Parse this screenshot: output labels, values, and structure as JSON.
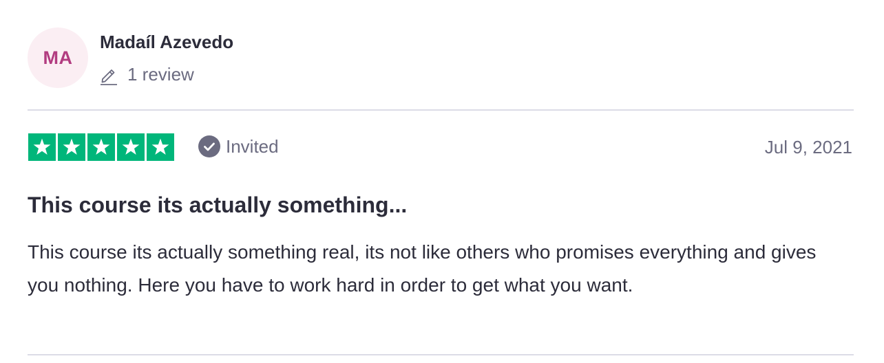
{
  "consumer": {
    "initials": "MA",
    "name": "Madaíl Azevedo",
    "review_count": "1 review"
  },
  "review": {
    "rating": 5,
    "rating_max": 5,
    "label": "Invited",
    "date": "Jul 9, 2021",
    "title": "This course its actually something...",
    "body": "This course its actually something real, its not like others who promises everything and gives you nothing. Here you have to work hard in order to get what you want."
  },
  "icons": {
    "review_count": "pencil-icon",
    "label": "check-circle-icon",
    "rating": "star-icon"
  },
  "colors": {
    "star_green": "#00b67a",
    "avatar_bg": "#fbeef3",
    "avatar_text": "#b23c80",
    "muted_text": "#6b6b80",
    "badge_gray": "#6b6b80"
  }
}
